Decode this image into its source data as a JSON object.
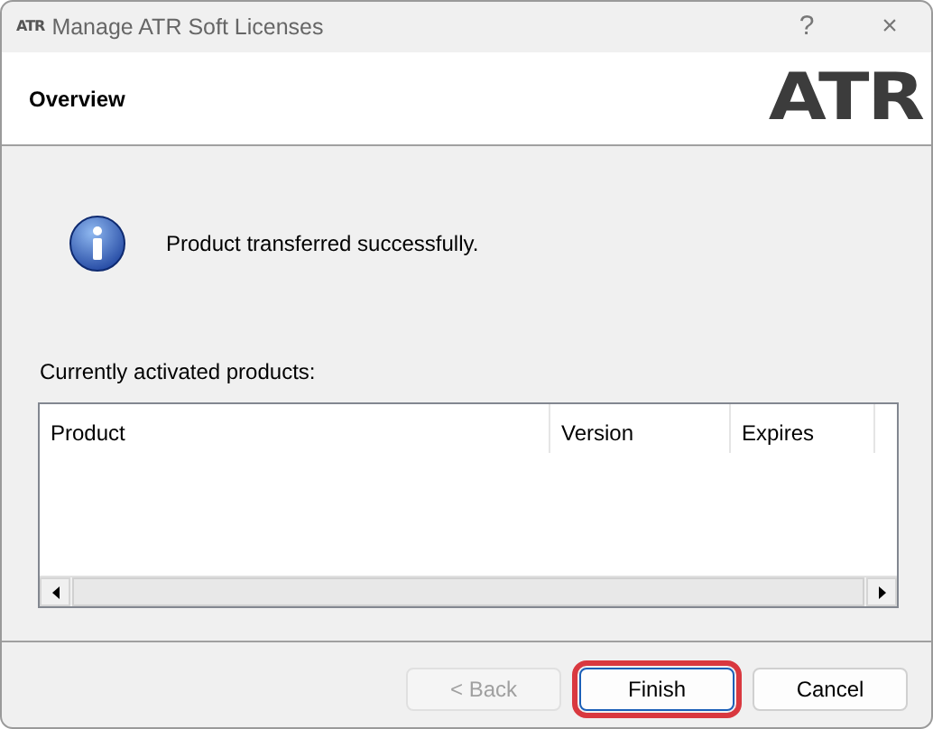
{
  "window": {
    "icon_text": "ATR",
    "title": "Manage ATR Soft Licenses",
    "controls": [
      "?",
      "×"
    ]
  },
  "header": {
    "title": "Overview",
    "logo_text": "ATR"
  },
  "message": {
    "kind": "info",
    "text": "Product transferred successfully."
  },
  "products": {
    "label": "Currently activated products:",
    "columns": [
      "Product",
      "Version",
      "Expires"
    ]
  },
  "buttons": [
    {
      "label": "< Back",
      "disabled": true,
      "highlighted": false
    },
    {
      "label": "Finish",
      "disabled": false,
      "highlighted": true
    },
    {
      "label": "Cancel",
      "disabled": false,
      "highlighted": false
    }
  ]
}
